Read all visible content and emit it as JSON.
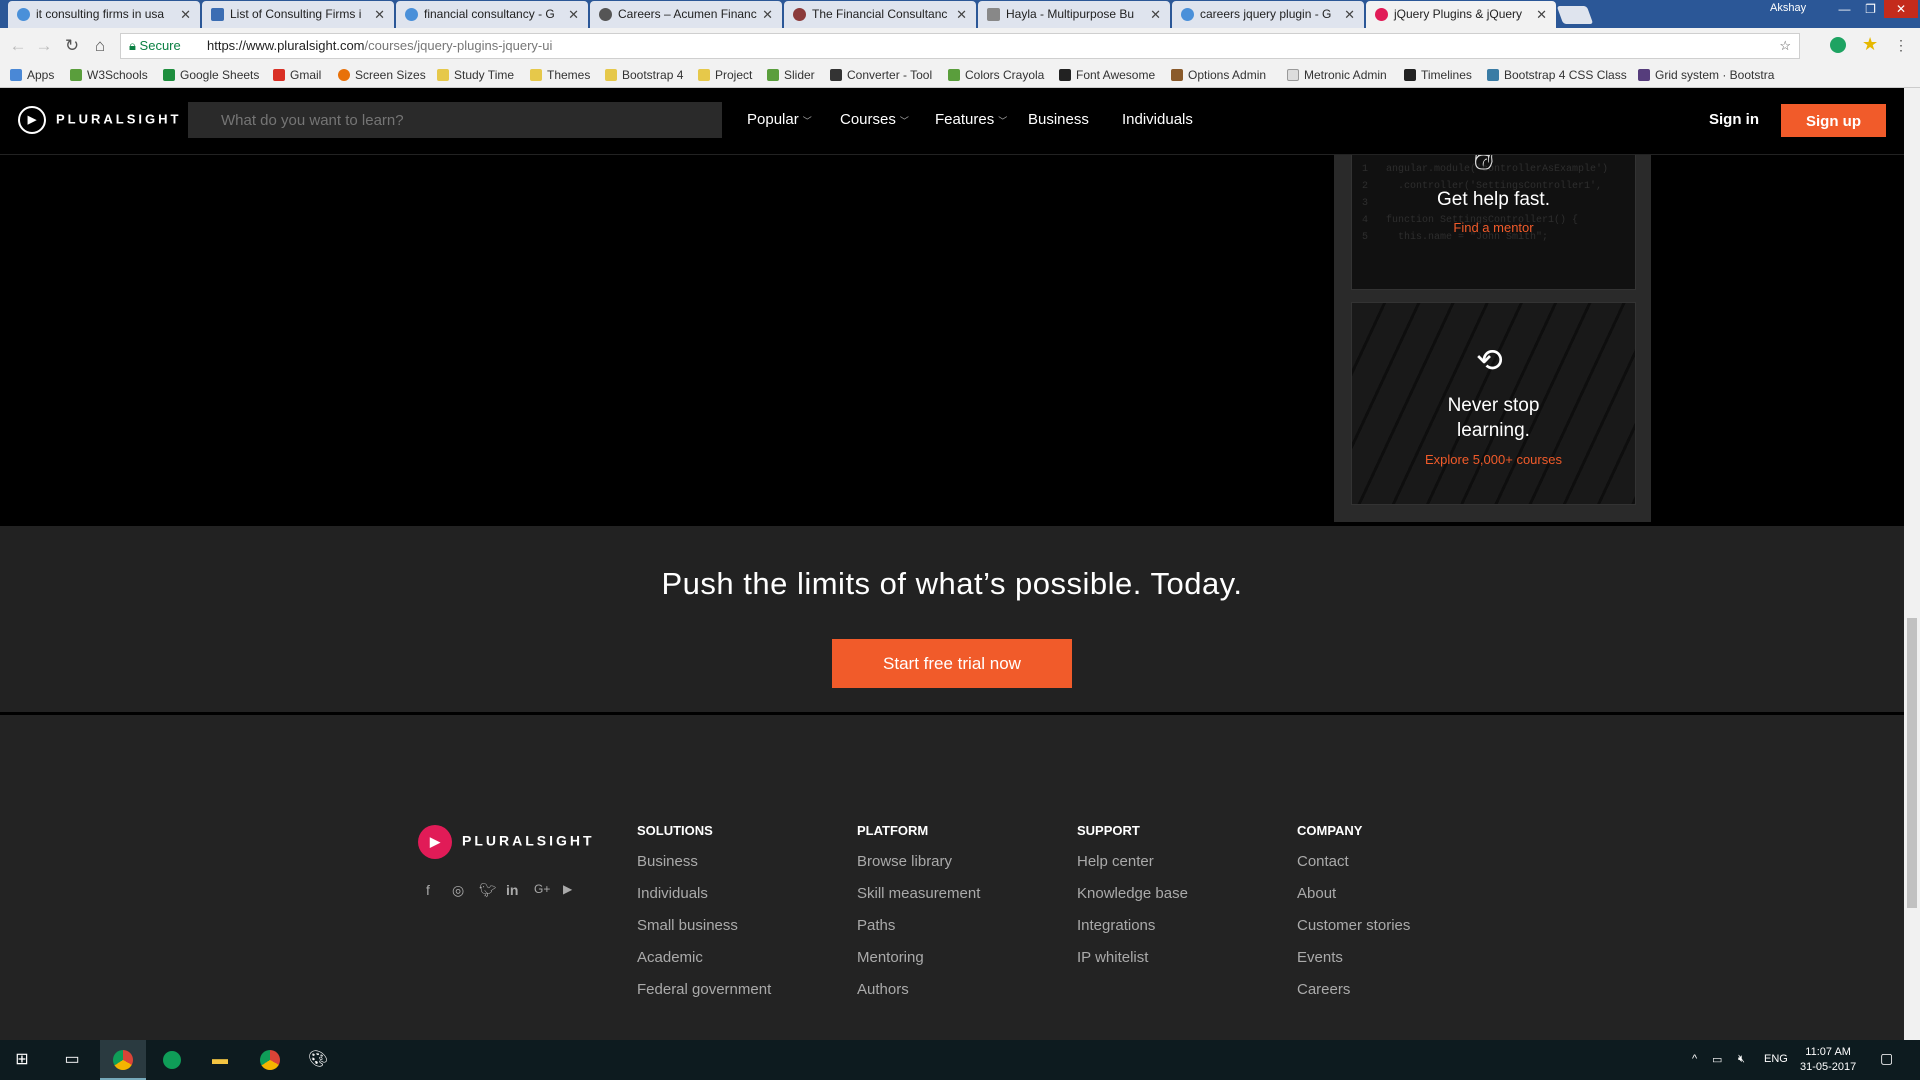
{
  "browser": {
    "tabs": [
      {
        "title": "it consulting firms in usa",
        "favicon": "google-icon"
      },
      {
        "title": "List of Consulting Firms i",
        "favicon": "page-icon"
      },
      {
        "title": "financial consultancy - G",
        "favicon": "google-icon"
      },
      {
        "title": "Careers – Acumen Financ",
        "favicon": "site-icon"
      },
      {
        "title": "The Financial Consultanc",
        "favicon": "site-icon"
      },
      {
        "title": "Hayla - Multipurpose Bu",
        "favicon": "page-icon"
      },
      {
        "title": "careers jquery plugin - G",
        "favicon": "google-icon"
      },
      {
        "title": "jQuery Plugins & jQuery",
        "favicon": "pluralsight-icon",
        "active": true
      }
    ],
    "profile_name": "Akshay",
    "secure_label": "Secure",
    "url_host": "https://www.pluralsight.com",
    "url_path": "/courses/jquery-plugins-jquery-ui",
    "bookmarks": [
      "Apps",
      "W3Schools",
      "Google Sheets",
      "Gmail",
      "Screen Sizes",
      "Study Time",
      "Themes",
      "Bootstrap 4",
      "Project",
      "Slider",
      "Converter - Tool",
      "Colors Crayola",
      "Font Awesome",
      "Options Admin",
      "Metronic Admin",
      "Timelines",
      "Bootstrap 4 CSS Class",
      "Grid system · Bootstra"
    ]
  },
  "header": {
    "logo_text": "PLURALSIGHT",
    "search_placeholder": "What do you want to learn?",
    "nav": [
      {
        "label": "Popular",
        "dropdown": true
      },
      {
        "label": "Courses",
        "dropdown": true
      },
      {
        "label": "Features",
        "dropdown": true
      },
      {
        "label": "Business",
        "dropdown": false
      },
      {
        "label": "Individuals",
        "dropdown": false
      }
    ],
    "signin": "Sign in",
    "signup": "Sign up"
  },
  "sidebar": {
    "help_title": "Get help fast.",
    "help_link": "Find a mentor",
    "learn_title": "Never stop learning.",
    "learn_link": "Explore 5,000+ courses"
  },
  "cta": {
    "heading": "Push the limits of what’s possible. Today.",
    "button": "Start free trial now"
  },
  "footer": {
    "logo_text": "PLURALSIGHT",
    "social": [
      "facebook-icon",
      "instagram-icon",
      "twitter-icon",
      "linkedin-icon",
      "google-plus-icon",
      "youtube-icon"
    ],
    "columns": [
      {
        "heading": "SOLUTIONS",
        "links": [
          "Business",
          "Individuals",
          "Small business",
          "Academic",
          "Federal government"
        ]
      },
      {
        "heading": "PLATFORM",
        "links": [
          "Browse library",
          "Skill measurement",
          "Paths",
          "Mentoring",
          "Authors"
        ]
      },
      {
        "heading": "SUPPORT",
        "links": [
          "Help center",
          "Knowledge base",
          "Integrations",
          "IP whitelist"
        ]
      },
      {
        "heading": "COMPANY",
        "links": [
          "Contact",
          "About",
          "Customer stories",
          "Events",
          "Careers"
        ]
      }
    ]
  },
  "taskbar": {
    "language": "ENG",
    "time": "11:07 AM",
    "date": "31-05-2017"
  },
  "colors": {
    "accent": "#f15b2a",
    "page_bg": "#000000",
    "cta_bg": "#222222",
    "footer_bg": "#232323",
    "brand_pink": "#e11b57"
  }
}
